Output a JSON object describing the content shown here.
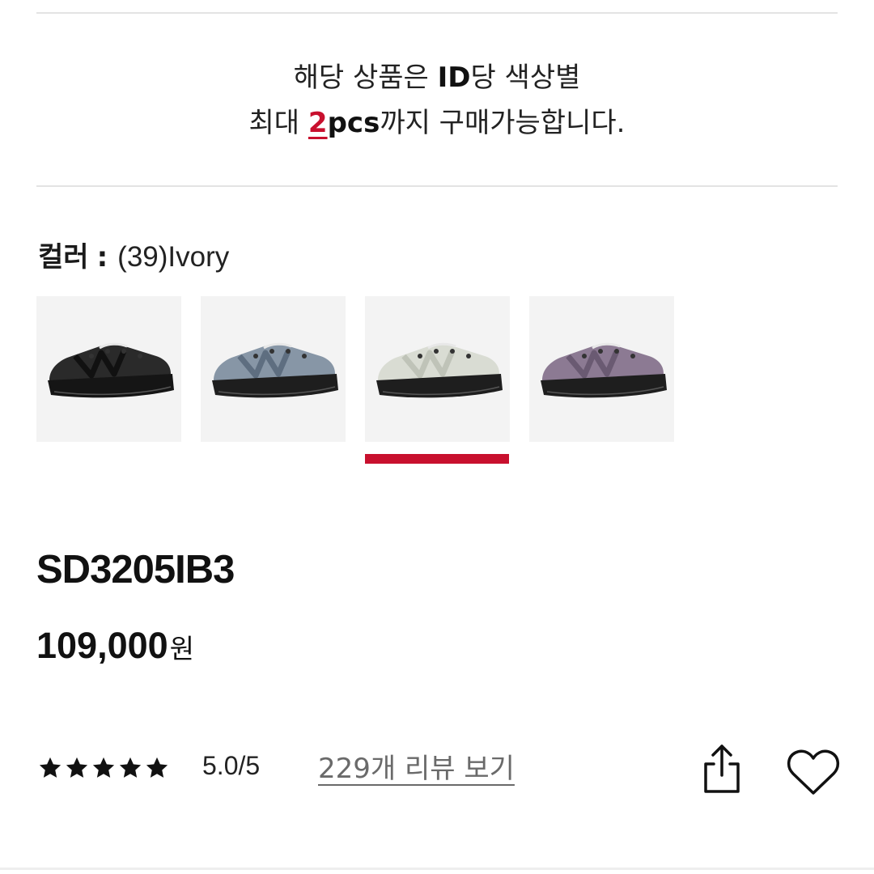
{
  "notice": {
    "line1_a": "해당 상품은 ",
    "line1_b": "ID",
    "line1_c": "당 색상별",
    "line2_a": "최대 ",
    "line2_b": "2",
    "line2_c": "pcs",
    "line2_d": "까지 구매가능합니다."
  },
  "color": {
    "label": "컬러",
    "separator": ":",
    "selected": "(39)Ivory"
  },
  "swatches": [
    {
      "icon": "shoe-black-icon",
      "upper": "#2a2a2a",
      "accent": "#111111",
      "sole": "#151515",
      "selected": false
    },
    {
      "icon": "shoe-blue-icon",
      "upper": "#8796a6",
      "accent": "#5e6e80",
      "sole": "#1e1e1e",
      "selected": false
    },
    {
      "icon": "shoe-ivory-icon",
      "upper": "#d9dcd3",
      "accent": "#bfc3b8",
      "sole": "#1e1e1e",
      "selected": true
    },
    {
      "icon": "shoe-purple-icon",
      "upper": "#8c7a93",
      "accent": "#6a5a72",
      "sole": "#1e1e1e",
      "selected": false
    }
  ],
  "product": {
    "code": "SD3205IB3",
    "price": "109,000",
    "currency": "원"
  },
  "reviews": {
    "rating": "5.0/5",
    "link_label": "229개 리뷰 보기",
    "stars": 5
  },
  "colors": {
    "accent": "#c8102e",
    "divider": "#e3e3e3"
  }
}
